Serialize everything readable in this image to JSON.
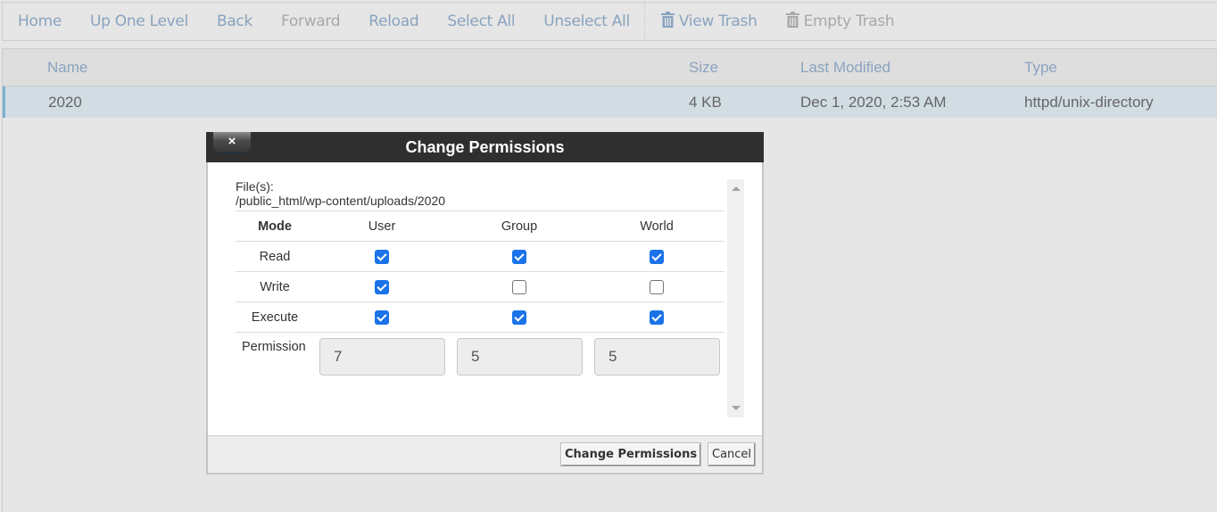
{
  "toolbar": {
    "items": [
      {
        "label": "Home",
        "enabled": true
      },
      {
        "label": "Up One Level",
        "enabled": true
      },
      {
        "label": "Back",
        "enabled": true
      },
      {
        "label": "Forward",
        "enabled": false
      },
      {
        "label": "Reload",
        "enabled": true
      },
      {
        "label": "Select All",
        "enabled": true
      },
      {
        "label": "Unselect All",
        "enabled": true
      }
    ],
    "view_trash": {
      "label": "View Trash",
      "icon": "trash-icon",
      "enabled": true
    },
    "empty_trash": {
      "label": "Empty Trash",
      "icon": "trash-icon",
      "enabled": false
    }
  },
  "file_table": {
    "columns": [
      "Name",
      "Size",
      "Last Modified",
      "Type"
    ],
    "rows": [
      {
        "name": "2020",
        "size": "4 KB",
        "modified": "Dec 1, 2020, 2:53 AM",
        "type": "httpd/unix-directory",
        "selected": true
      }
    ]
  },
  "dialog": {
    "title": "Change Permissions",
    "close_label": "×",
    "files_label": "File(s):",
    "files_path": "/public_html/wp-content/uploads/2020",
    "headers": [
      "Mode",
      "User",
      "Group",
      "World"
    ],
    "modes": [
      {
        "label": "Read",
        "user": true,
        "group": true,
        "world": true
      },
      {
        "label": "Write",
        "user": true,
        "group": false,
        "world": false
      },
      {
        "label": "Execute",
        "user": true,
        "group": true,
        "world": true
      }
    ],
    "permission_label": "Permission",
    "permission_values": {
      "user": "7",
      "group": "5",
      "world": "5"
    },
    "buttons": {
      "submit": "Change Permissions",
      "cancel": "Cancel"
    }
  },
  "colors": {
    "link": "#8aa3bf",
    "disabled": "#a8a8a8",
    "selected_row": "#d2dde3",
    "dialog_header": "#2f2f2f",
    "checkbox_checked": "#1a73e8"
  }
}
